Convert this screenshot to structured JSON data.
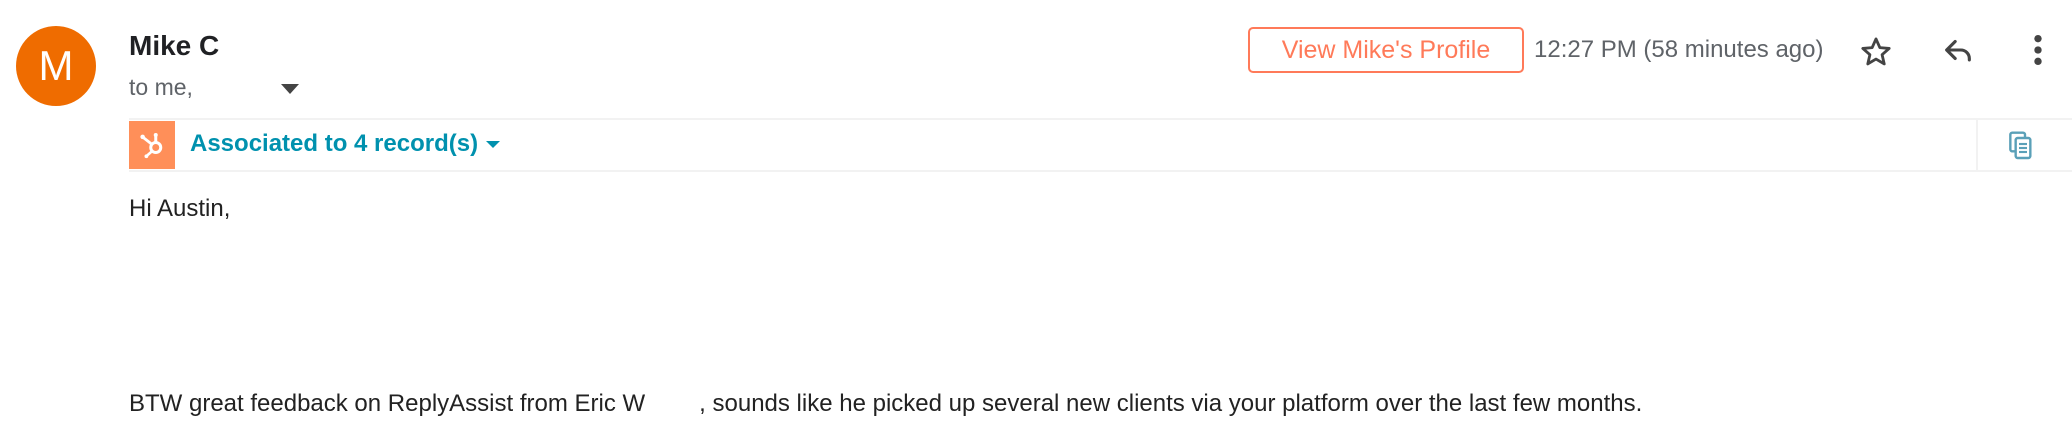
{
  "sender": {
    "avatar_letter": "M",
    "avatar_color": "#ef6c00",
    "name": "Mike C",
    "to_text": "to me,"
  },
  "header": {
    "profile_button": "View Mike's Profile",
    "timestamp": "12:27 PM (58 minutes ago)",
    "icons": [
      "star-icon",
      "reply-icon",
      "more-vert-icon"
    ]
  },
  "hubspot": {
    "brand_color": "#ff8f59",
    "link_color": "#0091ae",
    "associated_label": "Associated to 4 record(s)",
    "icons": [
      "hubspot-logo-icon",
      "copy-icon"
    ]
  },
  "body": {
    "greeting": "Hi Austin,",
    "line1_part1": "BTW great feedback on ReplyAssist from Eric W",
    "line1_part2": ", sounds like he picked up several new clients via your platform over the last few months."
  }
}
